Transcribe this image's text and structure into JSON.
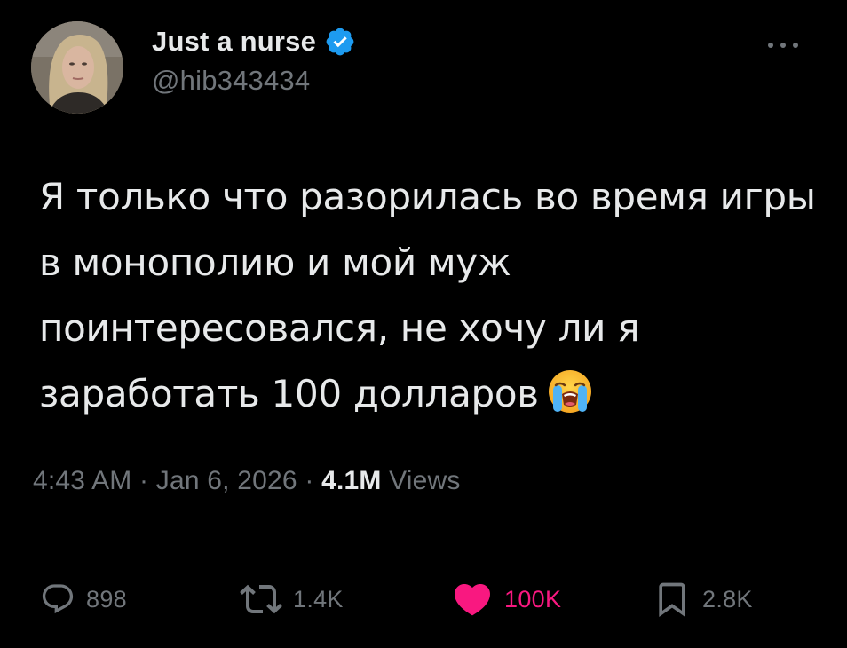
{
  "author": {
    "display_name": "Just a nurse",
    "handle": "@hib343434",
    "verified": true,
    "verified_color": "#1d9bf0"
  },
  "tweet": {
    "text": "Я только что разорилась во время игры в монополию и мой муж поинтересовался, не хочу ли я заработать 100 долларов",
    "emoji": "loudly-crying-face-emoji"
  },
  "meta": {
    "time": "4:43 AM",
    "separator": "·",
    "date": "Jan 6, 2026",
    "views_count": "4.1M",
    "views_label": "Views"
  },
  "actions": {
    "replies": "898",
    "reposts": "1.4K",
    "likes": "100K",
    "bookmarks": "2.8K",
    "like_color": "#f91880"
  },
  "icons": {
    "more": "more-horizontal-icon",
    "reply": "speech-bubble-icon",
    "repost": "repost-arrows-icon",
    "like": "heart-icon",
    "bookmark": "bookmark-icon"
  }
}
